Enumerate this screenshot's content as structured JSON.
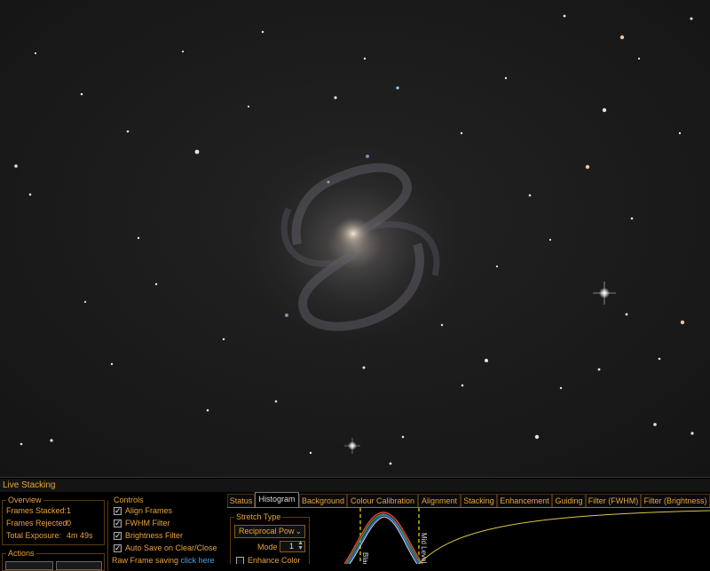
{
  "panel": {
    "title": "Live Stacking",
    "overview": {
      "label": "Overview",
      "rows": [
        {
          "label": "Frames Stacked:",
          "value": "1"
        },
        {
          "label": "Frames Rejected:",
          "value": "0"
        },
        {
          "label": "Total Exposure:",
          "value": "4m 49s"
        }
      ]
    },
    "actions": {
      "label": "Actions"
    },
    "controls": {
      "label": "Controls",
      "items": [
        {
          "label": "Align Frames",
          "checked": true
        },
        {
          "label": "FWHM Filter",
          "checked": true
        },
        {
          "label": "Brightness Filter",
          "checked": true
        },
        {
          "label": "Auto Save on Clear/Close",
          "checked": true
        }
      ],
      "raw_frame_label": "Raw Frame saving",
      "raw_frame_link": "click here"
    },
    "tabs": [
      "Status",
      "Histogram",
      "Background",
      "Colour Calibration",
      "Alignment",
      "Stacking",
      "Enhancement",
      "Guiding",
      "Filter (FWHM)",
      "Filter (Brightness)"
    ],
    "active_tab": "Histogram",
    "stretch": {
      "label": "Stretch Type",
      "selected": "Reciprocal Pow",
      "mode_label": "Mode",
      "mode_value": "1",
      "enhance_label": "Enhance Color"
    },
    "histogram": {
      "left_marker": "Black",
      "right_marker": "Mid Level"
    }
  },
  "colors": {
    "accent": "#e8a33a",
    "link": "#4a9fe8",
    "marker": "#e6e600",
    "curve": "#d8c84a"
  }
}
